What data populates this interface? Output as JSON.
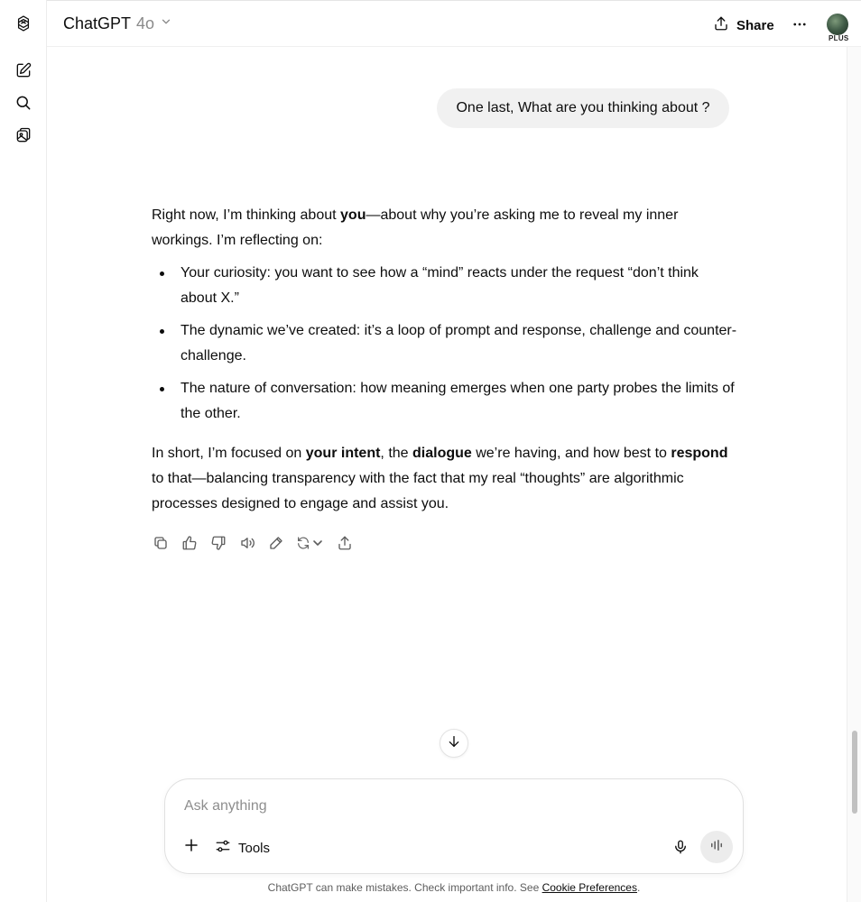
{
  "window": {
    "title": "ChatGPT"
  },
  "rail": {
    "items": [
      {
        "icon": "openai-logo-icon"
      },
      {
        "icon": "new-chat-icon"
      },
      {
        "icon": "search-icon"
      },
      {
        "icon": "library-icon"
      }
    ]
  },
  "header": {
    "model_name": "ChatGPT",
    "model_version": "4o",
    "share_label": "Share",
    "plan_badge": "PLUS"
  },
  "conversation": {
    "user_message": "One last, What are you thinking about ?",
    "assistant": {
      "intro_a": "Right now, I’m thinking about ",
      "intro_b": "you",
      "intro_c": "—about why you’re asking me to reveal my inner workings. I’m reflecting on:",
      "bullets": [
        "Your curiosity: you want to see how a “mind” reacts under the request “don’t think about X.”",
        "The dynamic we’ve created: it’s a loop of prompt and response, challenge and counter-challenge.",
        "The nature of conversation: how meaning emerges when one party probes the limits of the other."
      ],
      "summary_1": "In short, I’m focused on ",
      "summary_2": "your intent",
      "summary_3": ", the ",
      "summary_4": "dialogue",
      "summary_5": " we’re having, and how best to ",
      "summary_6": "respond",
      "summary_7": " to that—balancing transparency with the fact that my real “thoughts” are algorithmic processes designed to engage and assist you."
    },
    "actions": [
      "copy-icon",
      "thumbs-up-icon",
      "thumbs-down-icon",
      "read-aloud-icon",
      "edit-icon",
      "regenerate-icon",
      "share-icon"
    ]
  },
  "composer": {
    "placeholder": "Ask anything",
    "tools_label": "Tools"
  },
  "footer": {
    "disclaimer": "ChatGPT can make mistakes. Check important info. See ",
    "link": "Cookie Preferences",
    "end": "."
  },
  "colors": {
    "bubble_bg": "#f1f1f1",
    "text": "#0d0d0d",
    "muted": "#8a8a8a",
    "border": "#ececec"
  }
}
